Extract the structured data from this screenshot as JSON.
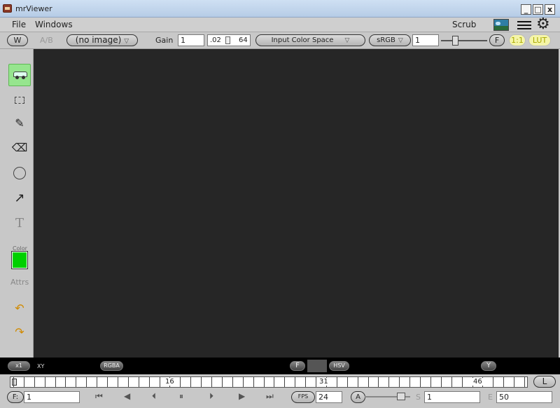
{
  "window": {
    "title": "mrViewer",
    "min": "_",
    "max": "□",
    "close": "x"
  },
  "menu": {
    "file": "File",
    "windows": "Windows",
    "scrub": "Scrub"
  },
  "toolbar": {
    "wipe": "W",
    "ab": "A/B",
    "image_select": "(no image)",
    "gain_label": "Gain",
    "gain_value": "1",
    "exposure_value": ".02",
    "gamma_value": "64",
    "input_color_space": "Input Color Space",
    "display": "sRGB",
    "display_gamma_value": "1",
    "f_button": "F",
    "one_to_one": "1:1",
    "lut": "LUT"
  },
  "tools": {
    "text_glyph": "T",
    "color_label": "Color",
    "color": "#00d000",
    "attrs_label": "Attrs"
  },
  "pixelbar": {
    "zoom": "x1",
    "xy": "XY",
    "rgba": "RGBA",
    "f": "F",
    "hsv": "HSV",
    "y": "Y"
  },
  "timeline": {
    "labels": [
      "16",
      "31",
      "46"
    ],
    "loop_button": "L"
  },
  "transport": {
    "frame_label": "F:",
    "frame": "1",
    "fps_label": "FPS",
    "fps": "24",
    "audio": "A",
    "start_label": "S",
    "start": "1",
    "end_label": "E",
    "end": "50"
  }
}
